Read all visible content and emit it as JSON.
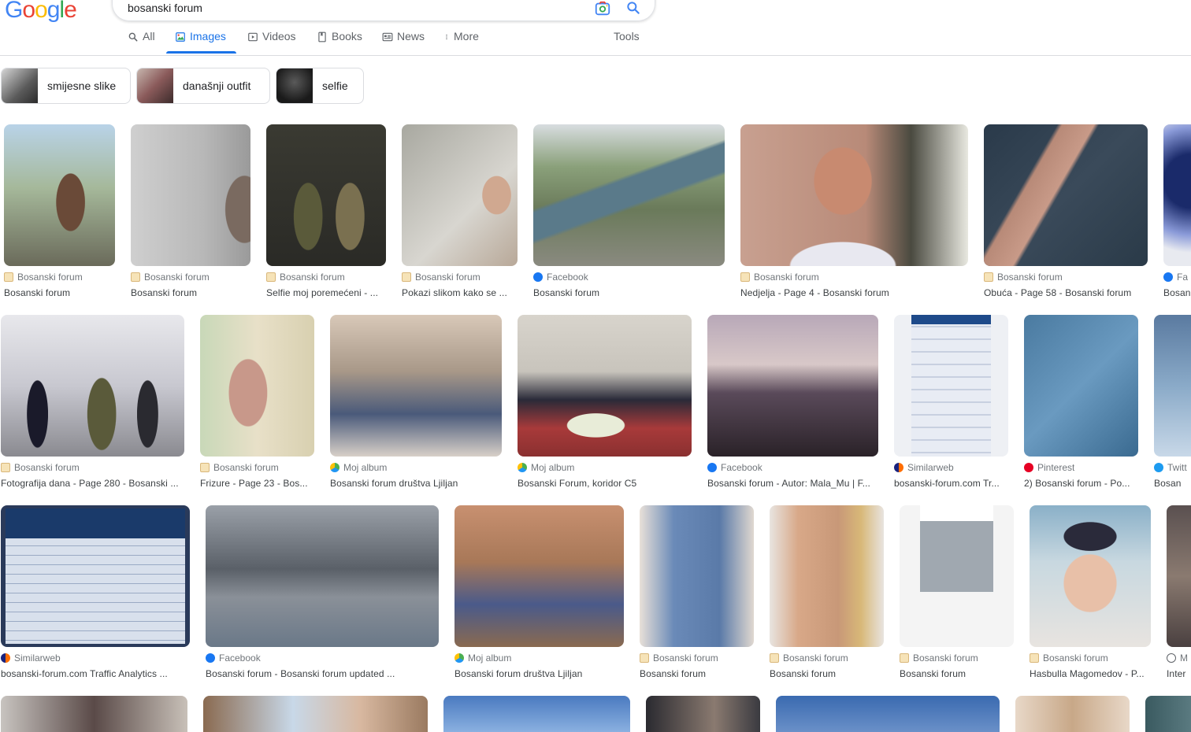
{
  "header": {
    "logo": [
      "G",
      "o",
      "o",
      "g",
      "l",
      "e"
    ],
    "logo_colors": [
      "#4285F4",
      "#EA4335",
      "#FBBC05",
      "#4285F4",
      "#34A853",
      "#EA4335"
    ],
    "search_value": "bosanski forum",
    "tabs": [
      {
        "label": "All",
        "icon": "search-icon"
      },
      {
        "label": "Images",
        "icon": "image-icon"
      },
      {
        "label": "Videos",
        "icon": "video-icon"
      },
      {
        "label": "Books",
        "icon": "book-icon"
      },
      {
        "label": "News",
        "icon": "news-icon"
      },
      {
        "label": "More",
        "icon": "more-vert-icon"
      },
      {
        "label": "Tools",
        "icon": ""
      }
    ],
    "active_tab": "Images",
    "accent": "#1a73e8"
  },
  "chips": [
    "smijesne slike",
    "današnji outfit",
    "selfie"
  ],
  "results": [
    [
      {
        "source": "Bosanski forum",
        "title": "Bosanski forum",
        "fav": "bf"
      },
      {
        "source": "Bosanski forum",
        "title": "Bosanski forum",
        "fav": "bf"
      },
      {
        "source": "Bosanski forum",
        "title": "Selfie moj poremećeni - ...",
        "fav": "bf"
      },
      {
        "source": "Bosanski forum",
        "title": "Pokazi slikom kako se ...",
        "fav": "bf"
      },
      {
        "source": "Facebook",
        "title": "Bosanski forum",
        "fav": "fb"
      },
      {
        "source": "Bosanski forum",
        "title": "Nedjelja - Page 4 - Bosanski forum",
        "fav": "bf"
      },
      {
        "source": "Bosanski forum",
        "title": "Obuća - Page 58 - Bosanski forum",
        "fav": "bf"
      },
      {
        "source": "Fa",
        "title": "Bosan",
        "fav": "fb"
      }
    ],
    [
      {
        "source": "Bosanski forum",
        "title": "Fotografija dana - Page 280 - Bosanski ...",
        "fav": "bf"
      },
      {
        "source": "Bosanski forum",
        "title": "Frizure - Page 23 - Bos...",
        "fav": "bf"
      },
      {
        "source": "Moj album",
        "title": "Bosanski forum društva Ljiljan",
        "fav": "moj"
      },
      {
        "source": "Moj album",
        "title": "Bosanski Forum, koridor C5",
        "fav": "moj"
      },
      {
        "source": "Facebook",
        "title": "Bosanski forum - Autor: Mala_Mu | F...",
        "fav": "fb"
      },
      {
        "source": "Similarweb",
        "title": "bosanski-forum.com Tr...",
        "fav": "sw"
      },
      {
        "source": "Pinterest",
        "title": "2) Bosanski forum - Po...",
        "fav": "pin"
      },
      {
        "source": "Twitt",
        "title": "Bosan",
        "fav": "tw"
      }
    ],
    [
      {
        "source": "Similarweb",
        "title": "bosanski-forum.com Traffic Analytics ...",
        "fav": "sw"
      },
      {
        "source": "Facebook",
        "title": "Bosanski forum - Bosanski forum updated ...",
        "fav": "fb"
      },
      {
        "source": "Moj album",
        "title": "Bosanski forum društva Ljiljan",
        "fav": "moj"
      },
      {
        "source": "Bosanski forum",
        "title": "Bosanski forum",
        "fav": "bf"
      },
      {
        "source": "Bosanski forum",
        "title": "Bosanski forum",
        "fav": "bf"
      },
      {
        "source": "Bosanski forum",
        "title": "Bosanski forum",
        "fav": "bf"
      },
      {
        "source": "Bosanski forum",
        "title": "Hasbulla Magomedov - P...",
        "fav": "bf"
      },
      {
        "source": "M",
        "title": "Inter",
        "fav": "gen"
      }
    ]
  ],
  "image_tones": [
    [
      "#7a8a6a",
      "#9c9c9c",
      "#3c3a30",
      "#c8c3bd",
      "#6f7a58",
      "#bda9a0",
      "#2f4a5a",
      "#4a5a90"
    ],
    [
      "#a9a4a8",
      "#d8d4ba",
      "#7a6a62",
      "#6a5a50",
      "#75707a",
      "#6a8aa8",
      "#5a8ab0",
      "#8a9aaa"
    ],
    [
      "#3a5a7a",
      "#5f6770",
      "#6a5a4a",
      "#6a8ab0",
      "#c8a080",
      "#e8e4e0",
      "#3a4a50",
      "#6a6060"
    ],
    [
      "#6a6a6a",
      "#9a7a6a",
      "#5a8ac0",
      "#3a3a40",
      "#6a8ab8",
      "#c8a888",
      "#3a5060"
    ]
  ]
}
